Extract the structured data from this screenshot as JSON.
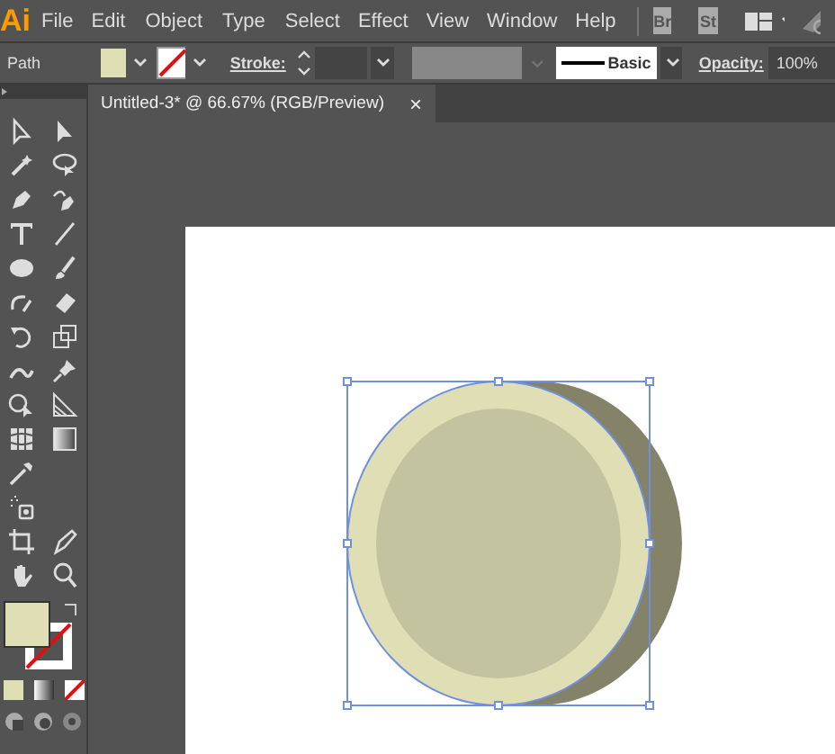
{
  "app": {
    "logo": "Ai"
  },
  "menu": [
    {
      "label": "File"
    },
    {
      "label": "Edit"
    },
    {
      "label": "Object"
    },
    {
      "label": "Type"
    },
    {
      "label": "Select"
    },
    {
      "label": "Effect"
    },
    {
      "label": "View"
    },
    {
      "label": "Window"
    },
    {
      "label": "Help"
    }
  ],
  "app_badges": [
    "Br",
    "St"
  ],
  "control_bar": {
    "selection": "Path",
    "stroke_label": "Stroke:",
    "brush": "Basic",
    "opacity_label": "Opacity:",
    "opacity": "100%"
  },
  "tabs": [
    {
      "label": "Untitled-3* @ 66.67% (RGB/Preview)",
      "close": "×",
      "selected": true
    }
  ]
}
